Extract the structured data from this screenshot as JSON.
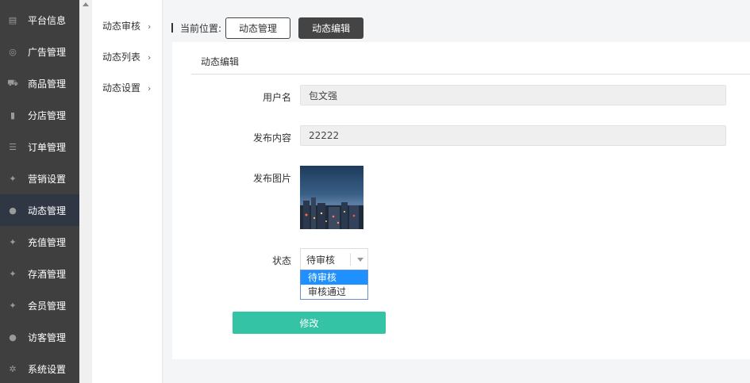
{
  "sidebar": {
    "items": [
      {
        "label": "平台信息",
        "icon": "newspaper-icon",
        "glyph": "▤"
      },
      {
        "label": "广告管理",
        "icon": "lifebuoy-icon",
        "glyph": "◎"
      },
      {
        "label": "商品管理",
        "icon": "cart-icon",
        "glyph": "⛟"
      },
      {
        "label": "分店管理",
        "icon": "building-icon",
        "glyph": "▮"
      },
      {
        "label": "订单管理",
        "icon": "list-icon",
        "glyph": "☰"
      },
      {
        "label": "营销设置",
        "icon": "gift-icon",
        "glyph": "✦"
      },
      {
        "label": "动态管理",
        "icon": "user-icon",
        "glyph": "●",
        "active": true
      },
      {
        "label": "充值管理",
        "icon": "gift-icon",
        "glyph": "✦"
      },
      {
        "label": "存酒管理",
        "icon": "gift-icon",
        "glyph": "✦"
      },
      {
        "label": "会员管理",
        "icon": "gift-icon",
        "glyph": "✦"
      },
      {
        "label": "访客管理",
        "icon": "user-icon",
        "glyph": "●"
      },
      {
        "label": "系统设置",
        "icon": "gear-icon",
        "glyph": "✲"
      }
    ]
  },
  "submenu": {
    "items": [
      {
        "label": "动态审核"
      },
      {
        "label": "动态列表"
      },
      {
        "label": "动态设置"
      }
    ],
    "chevron": "›"
  },
  "breadcrumb": {
    "label": "当前位置:",
    "items": [
      "动态管理",
      "动态编辑"
    ]
  },
  "panel": {
    "title": "动态编辑",
    "fields": {
      "username_label": "用户名",
      "username_value": "包文强",
      "content_label": "发布内容",
      "content_value": "22222",
      "image_label": "发布图片",
      "status_label": "状态",
      "status_value": "待审核"
    },
    "status_options": [
      "待审核",
      "审核通过"
    ],
    "submit_label": "修改"
  },
  "colors": {
    "sidebar_bg": "#3f3f3f",
    "sidebar_active": "#2f3744",
    "accent": "#35c3a5",
    "dropdown_highlight": "#1e90ff"
  }
}
